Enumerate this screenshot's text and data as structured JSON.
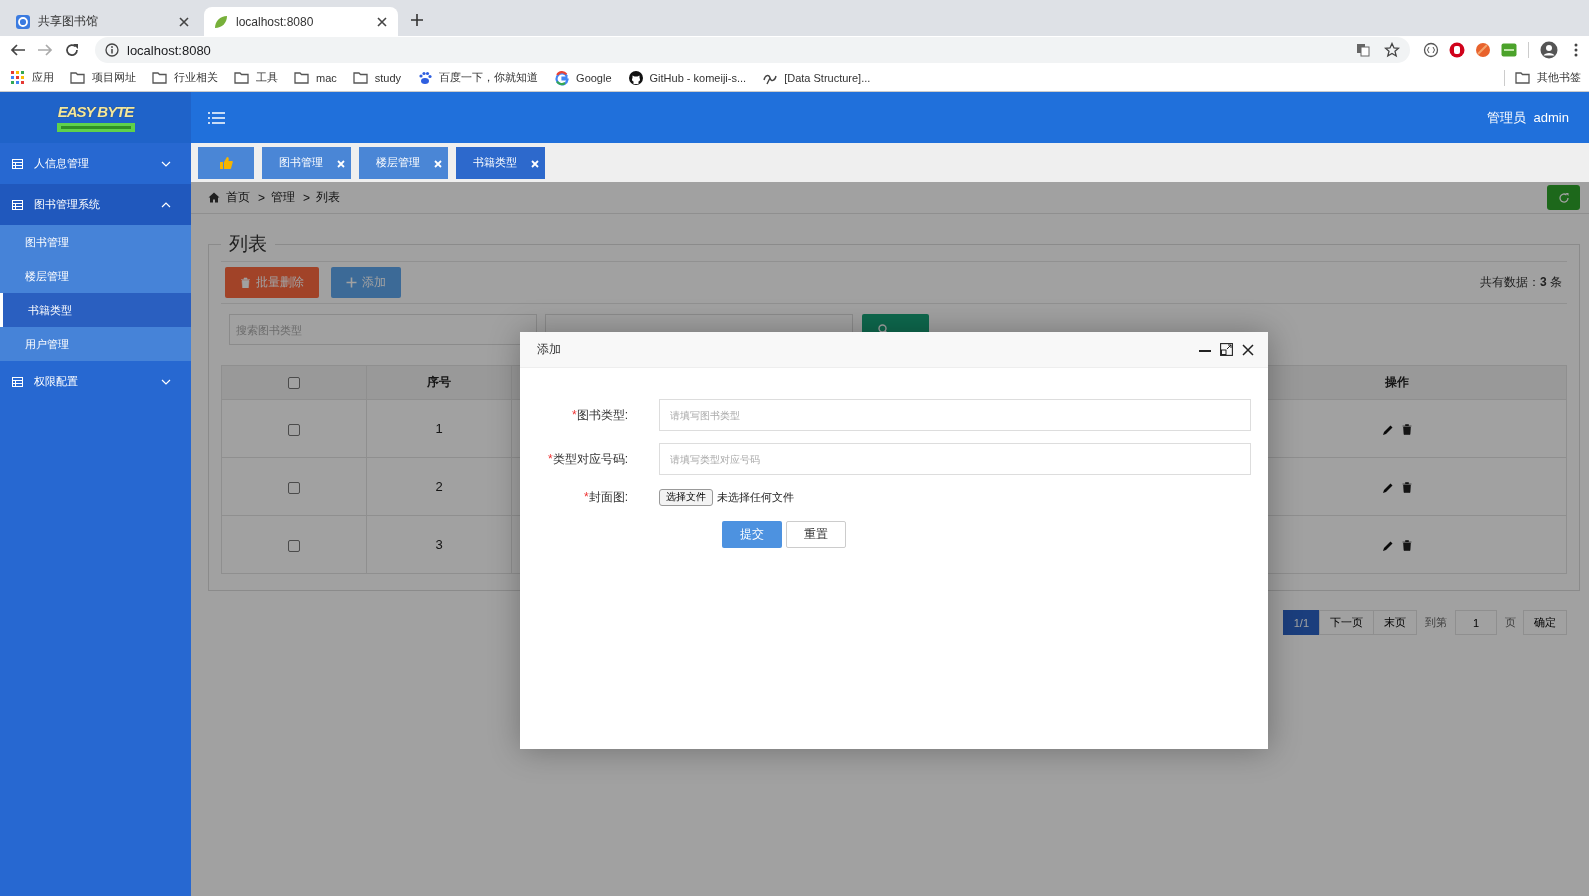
{
  "browser": {
    "tabs": [
      {
        "title": "共享图书馆",
        "kind": "ring",
        "selected": false
      },
      {
        "title": "localhost:8080",
        "kind": "leaf",
        "selected": true
      }
    ],
    "url": "localhost:8080",
    "bookmarks": [
      {
        "label": "应用",
        "kind": "apps"
      },
      {
        "label": "项目网址",
        "kind": "folder"
      },
      {
        "label": "行业相关",
        "kind": "folder"
      },
      {
        "label": "工具",
        "kind": "folder"
      },
      {
        "label": "mac",
        "kind": "folder"
      },
      {
        "label": "study",
        "kind": "folder"
      },
      {
        "label": "百度一下，你就知道",
        "kind": "paw"
      },
      {
        "label": "Google",
        "kind": "google"
      },
      {
        "label": "GitHub - komeiji-s...",
        "kind": "github"
      },
      {
        "label": "[Data Structure]...",
        "kind": "swirl"
      }
    ],
    "other_bookmarks": "其他书签"
  },
  "app": {
    "logo": {
      "title": "EASY BYTE"
    },
    "user": {
      "role": "管理员",
      "name": "admin"
    },
    "sidebar": [
      {
        "label": "人信息管理",
        "expanded": false
      },
      {
        "label": "图书管理系统",
        "expanded": true,
        "children": [
          {
            "label": "图书管理",
            "selected": false
          },
          {
            "label": "楼层管理",
            "selected": false
          },
          {
            "label": "书籍类型",
            "selected": true
          },
          {
            "label": "用户管理",
            "selected": false
          }
        ]
      },
      {
        "label": "权限配置",
        "expanded": false
      }
    ],
    "page_tabs": [
      {
        "kind": "home",
        "selected": false
      },
      {
        "kind": "page",
        "label": "图书管理",
        "selected": false
      },
      {
        "kind": "page",
        "label": "楼层管理",
        "selected": false
      },
      {
        "kind": "page",
        "label": "书籍类型",
        "selected": true
      }
    ],
    "breadcrumb": {
      "items": [
        "首页",
        "管理",
        "列表"
      ],
      "separator": ">"
    },
    "panel": {
      "title": "列表",
      "buttons": [
        {
          "label": "批量删除",
          "kind": "danger"
        },
        {
          "label": "添加",
          "kind": "primary"
        }
      ],
      "total": "共有数据：**3** 条",
      "search": {
        "fields": [
          {
            "kind": "text",
            "placeholder": "搜索图书类型"
          },
          {
            "kind": "text"
          }
        ]
      },
      "table": {
        "select_all": {
          "checked": false
        },
        "columns": [
          "序号",
          "操作"
        ],
        "rows": [
          {
            "checked": false,
            "index": "1"
          },
          {
            "checked": false,
            "index": "2"
          },
          {
            "checked": false,
            "index": "3"
          }
        ]
      },
      "pagination": {
        "pages": [
          {
            "label": "1/1",
            "selected": true
          },
          {
            "label": "下一页",
            "selected": false
          },
          {
            "label": "末页",
            "selected": false
          }
        ],
        "goto_label": "到第",
        "goto_value": "1",
        "unit": "页",
        "confirm": "确定"
      }
    },
    "modal": {
      "title": "添加",
      "fields": [
        {
          "kind": "text",
          "required_mark": "*",
          "label": "图书类型:",
          "placeholder": "请填写图书类型"
        },
        {
          "kind": "text",
          "required_mark": "*",
          "label": "类型对应号码:",
          "placeholder": "请填写类型对应号码"
        },
        {
          "kind": "file",
          "required_mark": "*",
          "label": "封面图:",
          "button": "选择文件",
          "status": "未选择任何文件"
        }
      ],
      "buttons": [
        {
          "label": "提交",
          "kind": "primary"
        },
        {
          "label": "重置",
          "kind": "default"
        }
      ]
    }
  }
}
